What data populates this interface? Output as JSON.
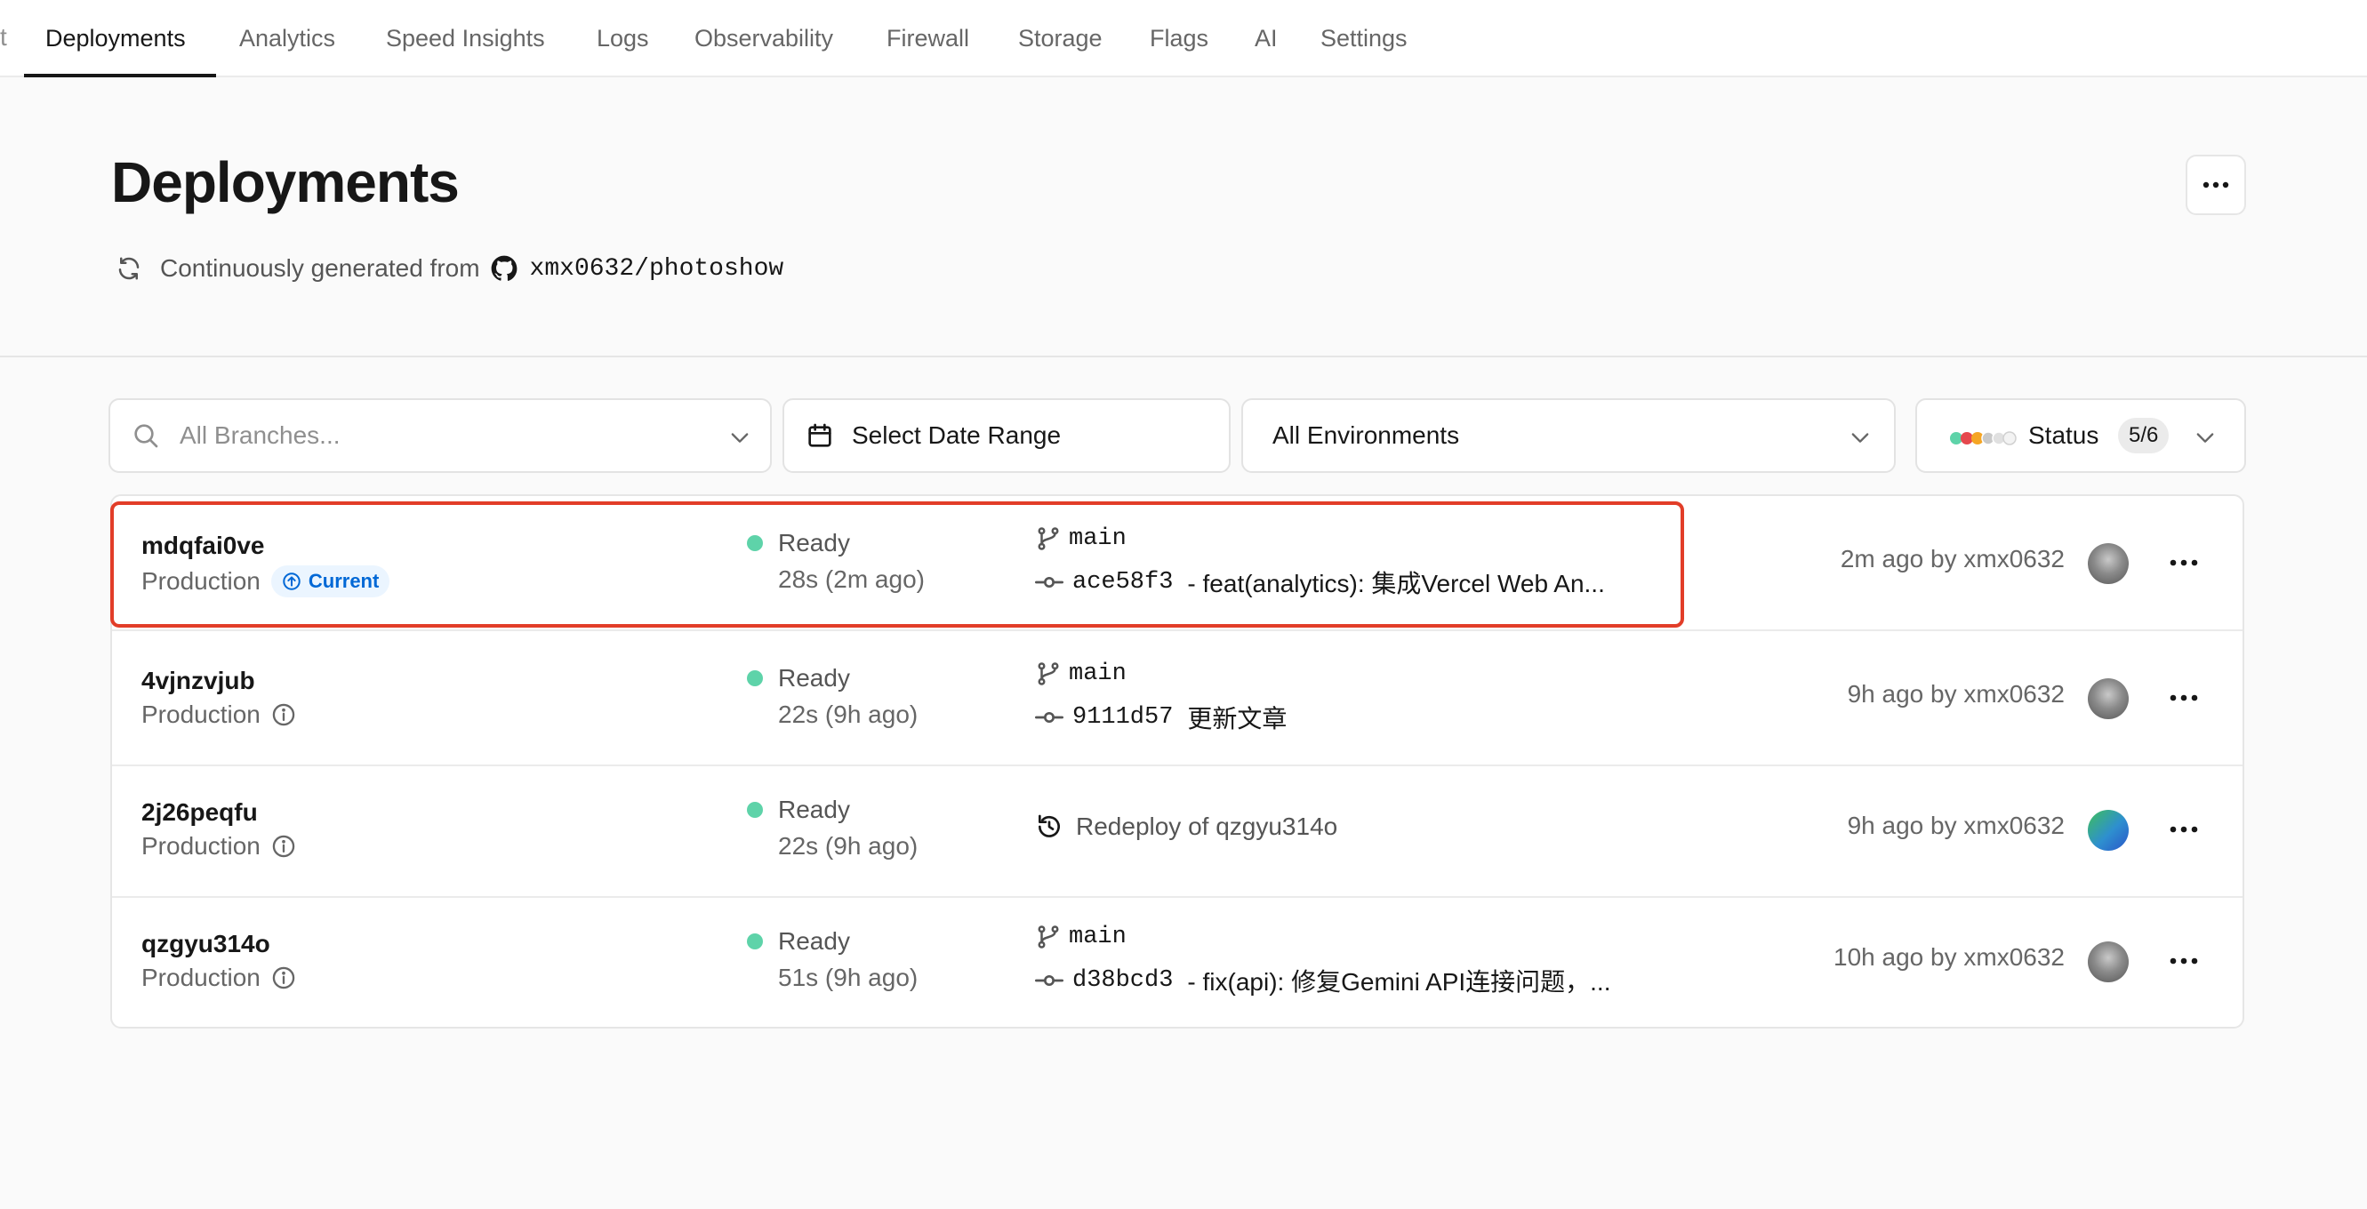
{
  "nav": {
    "edge_glyph": "t",
    "tabs": [
      {
        "label": "Deployments"
      },
      {
        "label": "Analytics"
      },
      {
        "label": "Speed Insights"
      },
      {
        "label": "Logs"
      },
      {
        "label": "Observability"
      },
      {
        "label": "Firewall"
      },
      {
        "label": "Storage"
      },
      {
        "label": "Flags"
      },
      {
        "label": "AI"
      },
      {
        "label": "Settings"
      }
    ],
    "active_tab": "Deployments"
  },
  "header": {
    "title": "Deployments",
    "source_text": "Continuously generated from",
    "repo": "xmx0632/photoshow"
  },
  "filters": {
    "branches_placeholder": "All Branches...",
    "date_label": "Select Date Range",
    "environment_label": "All Environments",
    "status_label": "Status",
    "status_count": "5/6",
    "status_dot_colors": [
      "#5ed3a9",
      "#e5484d",
      "#f5a524",
      "#c9c9c9",
      "#e0e0e0",
      "#f0f0f0"
    ]
  },
  "deployments": [
    {
      "id": "mdqfai0ve",
      "environment": "Production",
      "badge": "Current",
      "status": "Ready",
      "duration": "28s (2m ago)",
      "branch": "main",
      "commit_sha": "ace58f3",
      "commit_message": "- feat(analytics): 集成Vercel Web An...",
      "meta": "2m ago by xmx0632",
      "avatar": "cat-avatar"
    },
    {
      "id": "4vjnzvjub",
      "environment": "Production",
      "status": "Ready",
      "duration": "22s (9h ago)",
      "branch": "main",
      "commit_sha": "9111d57",
      "commit_message": "更新文章",
      "meta": "9h ago by xmx0632",
      "avatar": "cat-avatar"
    },
    {
      "id": "2j26peqfu",
      "environment": "Production",
      "status": "Ready",
      "duration": "22s (9h ago)",
      "redeploy_text": "Redeploy of qzgyu314o",
      "meta": "9h ago by xmx0632",
      "avatar": "gradient-avatar"
    },
    {
      "id": "qzgyu314o",
      "environment": "Production",
      "status": "Ready",
      "duration": "51s (9h ago)",
      "branch": "main",
      "commit_sha": "d38bcd3",
      "commit_message": "- fix(api): 修复Gemini API连接问题，...",
      "meta": "10h ago by xmx0632",
      "avatar": "cat-avatar"
    }
  ],
  "colors": {
    "ready": "#5ed3a9",
    "highlight": "#e23d28",
    "badge_bg": "#ebf5ff",
    "badge_text": "#0068d6"
  }
}
